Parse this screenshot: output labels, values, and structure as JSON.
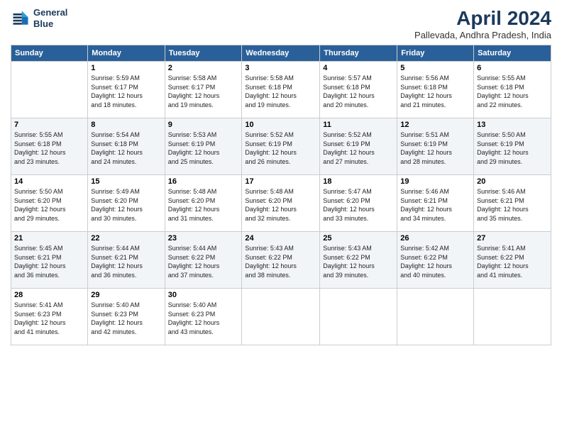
{
  "logo": {
    "line1": "General",
    "line2": "Blue"
  },
  "title": "April 2024",
  "subtitle": "Pallevada, Andhra Pradesh, India",
  "days_header": [
    "Sunday",
    "Monday",
    "Tuesday",
    "Wednesday",
    "Thursday",
    "Friday",
    "Saturday"
  ],
  "weeks": [
    [
      {
        "day": "",
        "info": ""
      },
      {
        "day": "1",
        "info": "Sunrise: 5:59 AM\nSunset: 6:17 PM\nDaylight: 12 hours\nand 18 minutes."
      },
      {
        "day": "2",
        "info": "Sunrise: 5:58 AM\nSunset: 6:17 PM\nDaylight: 12 hours\nand 19 minutes."
      },
      {
        "day": "3",
        "info": "Sunrise: 5:58 AM\nSunset: 6:18 PM\nDaylight: 12 hours\nand 19 minutes."
      },
      {
        "day": "4",
        "info": "Sunrise: 5:57 AM\nSunset: 6:18 PM\nDaylight: 12 hours\nand 20 minutes."
      },
      {
        "day": "5",
        "info": "Sunrise: 5:56 AM\nSunset: 6:18 PM\nDaylight: 12 hours\nand 21 minutes."
      },
      {
        "day": "6",
        "info": "Sunrise: 5:55 AM\nSunset: 6:18 PM\nDaylight: 12 hours\nand 22 minutes."
      }
    ],
    [
      {
        "day": "7",
        "info": "Sunrise: 5:55 AM\nSunset: 6:18 PM\nDaylight: 12 hours\nand 23 minutes."
      },
      {
        "day": "8",
        "info": "Sunrise: 5:54 AM\nSunset: 6:18 PM\nDaylight: 12 hours\nand 24 minutes."
      },
      {
        "day": "9",
        "info": "Sunrise: 5:53 AM\nSunset: 6:19 PM\nDaylight: 12 hours\nand 25 minutes."
      },
      {
        "day": "10",
        "info": "Sunrise: 5:52 AM\nSunset: 6:19 PM\nDaylight: 12 hours\nand 26 minutes."
      },
      {
        "day": "11",
        "info": "Sunrise: 5:52 AM\nSunset: 6:19 PM\nDaylight: 12 hours\nand 27 minutes."
      },
      {
        "day": "12",
        "info": "Sunrise: 5:51 AM\nSunset: 6:19 PM\nDaylight: 12 hours\nand 28 minutes."
      },
      {
        "day": "13",
        "info": "Sunrise: 5:50 AM\nSunset: 6:19 PM\nDaylight: 12 hours\nand 29 minutes."
      }
    ],
    [
      {
        "day": "14",
        "info": "Sunrise: 5:50 AM\nSunset: 6:20 PM\nDaylight: 12 hours\nand 29 minutes."
      },
      {
        "day": "15",
        "info": "Sunrise: 5:49 AM\nSunset: 6:20 PM\nDaylight: 12 hours\nand 30 minutes."
      },
      {
        "day": "16",
        "info": "Sunrise: 5:48 AM\nSunset: 6:20 PM\nDaylight: 12 hours\nand 31 minutes."
      },
      {
        "day": "17",
        "info": "Sunrise: 5:48 AM\nSunset: 6:20 PM\nDaylight: 12 hours\nand 32 minutes."
      },
      {
        "day": "18",
        "info": "Sunrise: 5:47 AM\nSunset: 6:20 PM\nDaylight: 12 hours\nand 33 minutes."
      },
      {
        "day": "19",
        "info": "Sunrise: 5:46 AM\nSunset: 6:21 PM\nDaylight: 12 hours\nand 34 minutes."
      },
      {
        "day": "20",
        "info": "Sunrise: 5:46 AM\nSunset: 6:21 PM\nDaylight: 12 hours\nand 35 minutes."
      }
    ],
    [
      {
        "day": "21",
        "info": "Sunrise: 5:45 AM\nSunset: 6:21 PM\nDaylight: 12 hours\nand 36 minutes."
      },
      {
        "day": "22",
        "info": "Sunrise: 5:44 AM\nSunset: 6:21 PM\nDaylight: 12 hours\nand 36 minutes."
      },
      {
        "day": "23",
        "info": "Sunrise: 5:44 AM\nSunset: 6:22 PM\nDaylight: 12 hours\nand 37 minutes."
      },
      {
        "day": "24",
        "info": "Sunrise: 5:43 AM\nSunset: 6:22 PM\nDaylight: 12 hours\nand 38 minutes."
      },
      {
        "day": "25",
        "info": "Sunrise: 5:43 AM\nSunset: 6:22 PM\nDaylight: 12 hours\nand 39 minutes."
      },
      {
        "day": "26",
        "info": "Sunrise: 5:42 AM\nSunset: 6:22 PM\nDaylight: 12 hours\nand 40 minutes."
      },
      {
        "day": "27",
        "info": "Sunrise: 5:41 AM\nSunset: 6:22 PM\nDaylight: 12 hours\nand 41 minutes."
      }
    ],
    [
      {
        "day": "28",
        "info": "Sunrise: 5:41 AM\nSunset: 6:23 PM\nDaylight: 12 hours\nand 41 minutes."
      },
      {
        "day": "29",
        "info": "Sunrise: 5:40 AM\nSunset: 6:23 PM\nDaylight: 12 hours\nand 42 minutes."
      },
      {
        "day": "30",
        "info": "Sunrise: 5:40 AM\nSunset: 6:23 PM\nDaylight: 12 hours\nand 43 minutes."
      },
      {
        "day": "",
        "info": ""
      },
      {
        "day": "",
        "info": ""
      },
      {
        "day": "",
        "info": ""
      },
      {
        "day": "",
        "info": ""
      }
    ]
  ]
}
